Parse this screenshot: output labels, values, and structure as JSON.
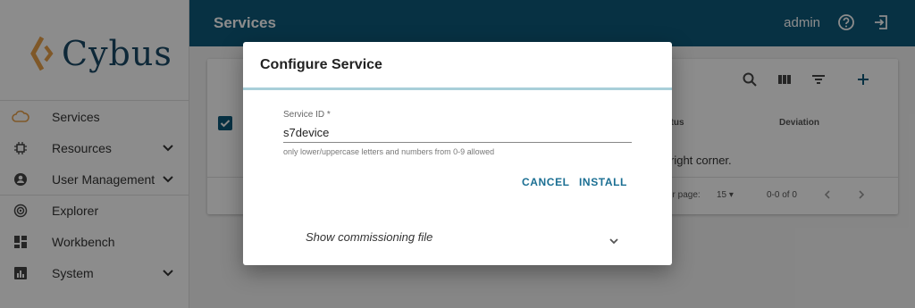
{
  "app": {
    "logo_text": "Cybus"
  },
  "sidebar": {
    "items": [
      {
        "label": "Services",
        "icon": "cloud-icon",
        "expandable": false
      },
      {
        "label": "Resources",
        "icon": "chip-icon",
        "expandable": true
      },
      {
        "label": "User Management",
        "icon": "globe-user-icon",
        "expandable": true
      },
      {
        "label": "Explorer",
        "icon": "radar-icon",
        "expandable": false
      },
      {
        "label": "Workbench",
        "icon": "dashboard-icon",
        "expandable": false
      },
      {
        "label": "System",
        "icon": "chart-icon",
        "expandable": true
      }
    ]
  },
  "header": {
    "title": "Services",
    "user": "admin"
  },
  "table": {
    "headers": [
      "Status",
      "Deviation"
    ],
    "header_status_visible": "atus",
    "empty_message": "right corner.",
    "rows_per_page_label": "er page:",
    "rows_per_page": "15",
    "range": "0-0 of 0"
  },
  "dialog": {
    "title": "Configure Service",
    "field": {
      "label": "Service ID *",
      "value": "s7device",
      "helper": "only lower/uppercase letters and numbers from 0-9 allowed"
    },
    "cancel_label": "CANCEL",
    "install_label": "INSTALL",
    "expander_label": "Show commissioning file"
  },
  "colors": {
    "primary": "#0e5a7b",
    "accent": "#e8a04a",
    "button": "#1b6f93",
    "divider": "#a8cfd9"
  }
}
